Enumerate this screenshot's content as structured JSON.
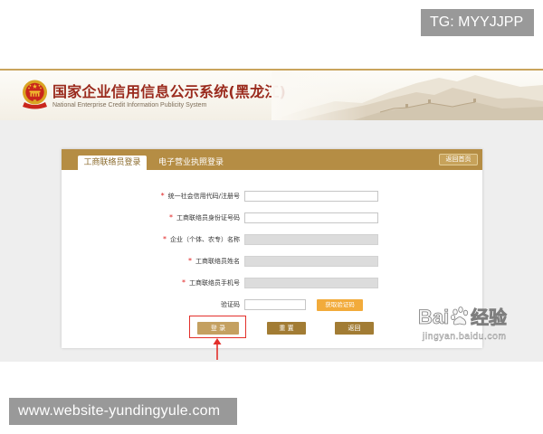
{
  "watermarks": {
    "tg": "TG: MYYJJPP",
    "site": "www.website-yundingyule.com",
    "baidu_prefix": "Bai",
    "baidu_suffix": "经验",
    "baidu_url": "jingyan.baidu.com",
    "baidu_icon": "paw-icon"
  },
  "header": {
    "title": "国家企业信用信息公示系统(黑龙江)",
    "subtitle": "National Enterprise Credit Information Publicity System",
    "emblem_icon": "national-emblem-icon"
  },
  "login_panel": {
    "tabs": [
      {
        "label": "工商联络员登录",
        "active": true
      },
      {
        "label": "电子营业执照登录",
        "active": false
      }
    ],
    "home_button": "返回首页",
    "required_mark": "*",
    "fields": [
      {
        "label": "统一社会信用代码/注册号",
        "required": true,
        "value": "",
        "disabled": false
      },
      {
        "label": "工商联络员身份证号码",
        "required": true,
        "value": "",
        "disabled": false
      },
      {
        "label": "企业（个体、农专）名称",
        "required": true,
        "value": "",
        "disabled": true
      },
      {
        "label": "工商联络员姓名",
        "required": true,
        "value": "",
        "disabled": true
      },
      {
        "label": "工商联络员手机号",
        "required": true,
        "value": "",
        "disabled": true
      }
    ],
    "captcha": {
      "label": "验证码",
      "value": "",
      "button": "获取验证码"
    },
    "buttons": {
      "login": "登 录",
      "reset": "重 置",
      "back": "返回"
    }
  },
  "annotation": {
    "arrow_icon": "arrow-up-icon"
  },
  "colors": {
    "accent": "#b58d44",
    "button": "#a27c34",
    "login_button": "#c4a060",
    "title": "#9a2a1d",
    "required": "#e02020",
    "captcha_button": "#f2ab3b",
    "annotation": "#e3302b",
    "watermark_bg": "#999999"
  }
}
